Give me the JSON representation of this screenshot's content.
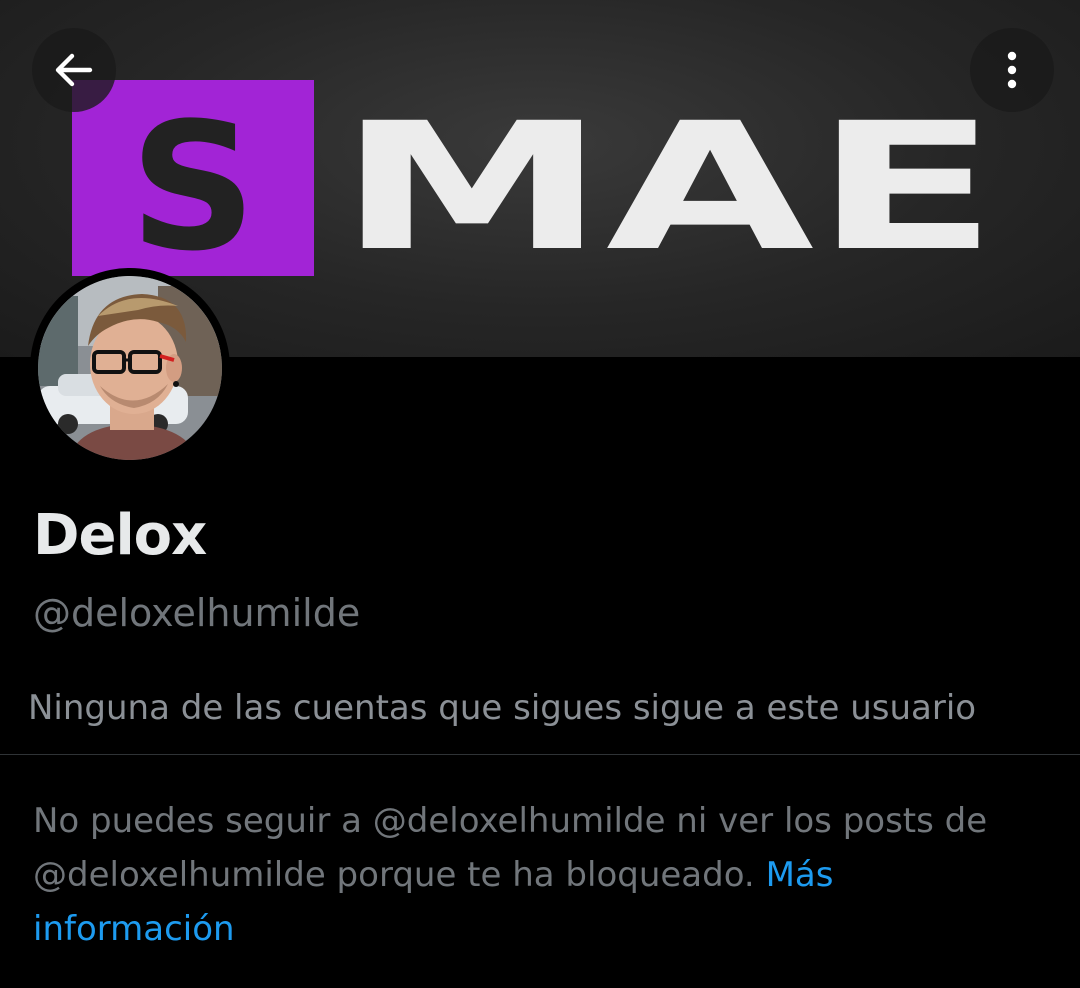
{
  "banner": {
    "logo_letter_box": "S",
    "logo_rest": "MAE",
    "accent_color": "#a224d6"
  },
  "header": {
    "back_icon": "arrow-left-icon",
    "more_icon": "more-vertical-icon"
  },
  "profile": {
    "display_name": "Delox",
    "handle": "@deloxelhumilde",
    "followers_note": "Ninguna de las cuentas que sigues sigue a este usuario"
  },
  "blocked": {
    "message": "No puedes seguir a @deloxelhumilde ni ver los posts de @deloxelhumilde porque te ha bloqueado.",
    "link_label": "Más información",
    "link_color": "#1d9bf0"
  }
}
